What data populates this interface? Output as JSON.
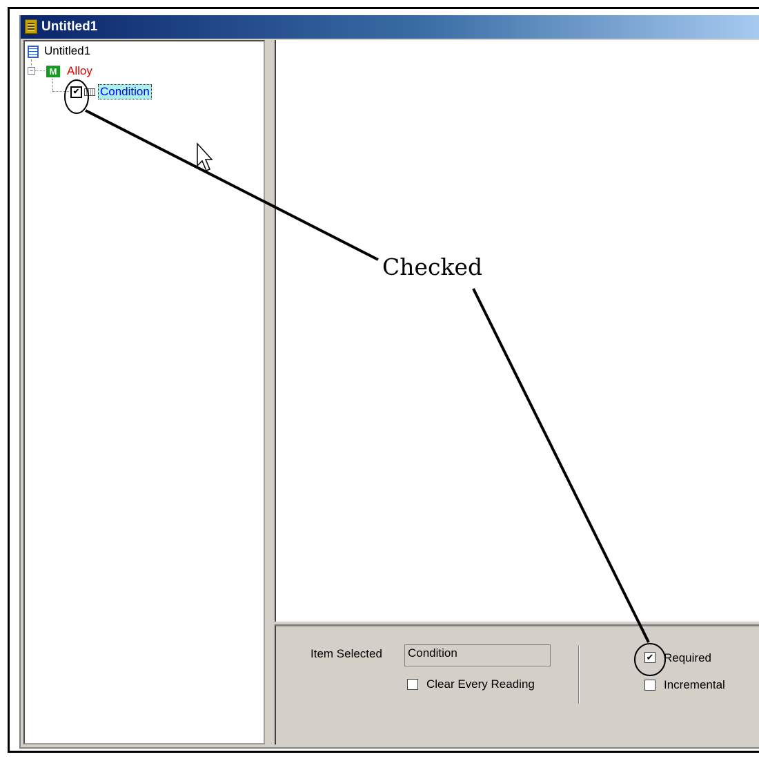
{
  "window": {
    "title": "Untitled1"
  },
  "tree": {
    "root_label": "Untitled1",
    "expander": "−",
    "group": {
      "label": "Alloy",
      "icon_letter": "M"
    },
    "item": {
      "label": "Condition",
      "checked_mark": "✔"
    }
  },
  "properties": {
    "item_selected_label": "Item Selected",
    "item_selected_value": "Condition",
    "clear_every_reading_label": "Clear Every Reading",
    "clear_every_reading_checked": false,
    "required_label": "Required",
    "required_checked": true,
    "required_mark": "✔",
    "incremental_label": "Incremental",
    "incremental_checked": false
  },
  "annotation": {
    "text": "Checked"
  },
  "colors": {
    "group_label": "#e00000",
    "item_label": "#0000ff",
    "item_highlight": "#aef0ef",
    "titlebar": "#0a246a"
  }
}
